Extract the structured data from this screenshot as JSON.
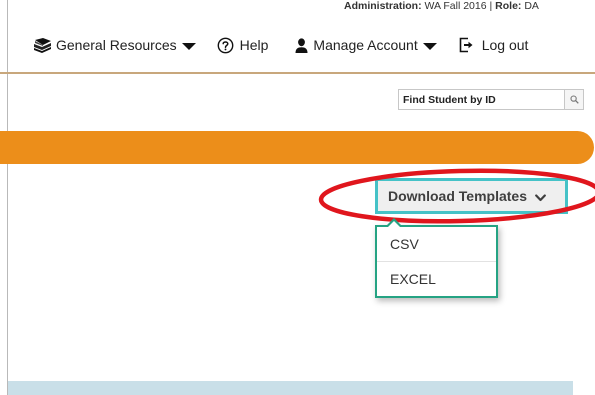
{
  "header": {
    "administration_label": "Administration:",
    "administration_value": "WA Fall 2016",
    "separator": "|",
    "role_label": "Role:",
    "role_value": "DA"
  },
  "nav": {
    "general_resources": {
      "label": "General Resources",
      "icon": "books-icon"
    },
    "help": {
      "label": "Help",
      "icon": "question-circle-icon"
    },
    "manage_account": {
      "label": "Manage Account",
      "icon": "user-icon"
    },
    "log_out": {
      "label": "Log out",
      "icon": "logout-icon"
    }
  },
  "search": {
    "placeholder": "Find Student by ID",
    "icon": "search-icon"
  },
  "download_templates": {
    "label": "Download Templates",
    "icon": "chevron-down-icon",
    "options": [
      "CSV",
      "EXCEL"
    ]
  },
  "colors": {
    "accent_orange": "#ec8e1a",
    "button_border_teal": "#45c2c7",
    "dropdown_border_green": "#25a383",
    "highlight_ellipse_red": "#e0161d",
    "divider_tan": "#c8a77c",
    "bottom_band_blue": "#c9dfe8"
  }
}
